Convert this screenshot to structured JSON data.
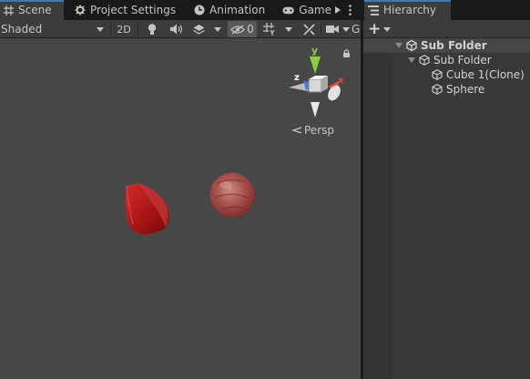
{
  "scene_tabs": [
    {
      "label": "Scene",
      "icon": "grid-icon"
    },
    {
      "label": "Project Settings",
      "icon": "gear-icon"
    },
    {
      "label": "Animation",
      "icon": "clock-icon"
    },
    {
      "label": "Game",
      "icon": "gamepad-icon"
    }
  ],
  "scene_toolbar": {
    "shading_mode": "Shaded",
    "mode_2d": "2D",
    "hidden_count": "0",
    "truncated_label": "G"
  },
  "gizmo": {
    "axis_y": "y",
    "axis_x": "x",
    "axis_z": "z",
    "projection": "Persp"
  },
  "hierarchy": {
    "tab_label": "Hierarchy",
    "add_label": "+",
    "items": [
      {
        "label": "Sub Folder",
        "kind": "scene"
      },
      {
        "label": "Sub Folder",
        "kind": "gameobject"
      },
      {
        "label": "Cube 1(Clone)",
        "kind": "gameobject"
      },
      {
        "label": "Sphere",
        "kind": "gameobject"
      }
    ]
  },
  "colors": {
    "accent": "#3a79bb",
    "viewport": "#474747",
    "object_red": "#b31c1c",
    "gizmo_y": "#8bd13e",
    "gizmo_x": "#e8482e",
    "gizmo_z": "#3d7fe0"
  }
}
